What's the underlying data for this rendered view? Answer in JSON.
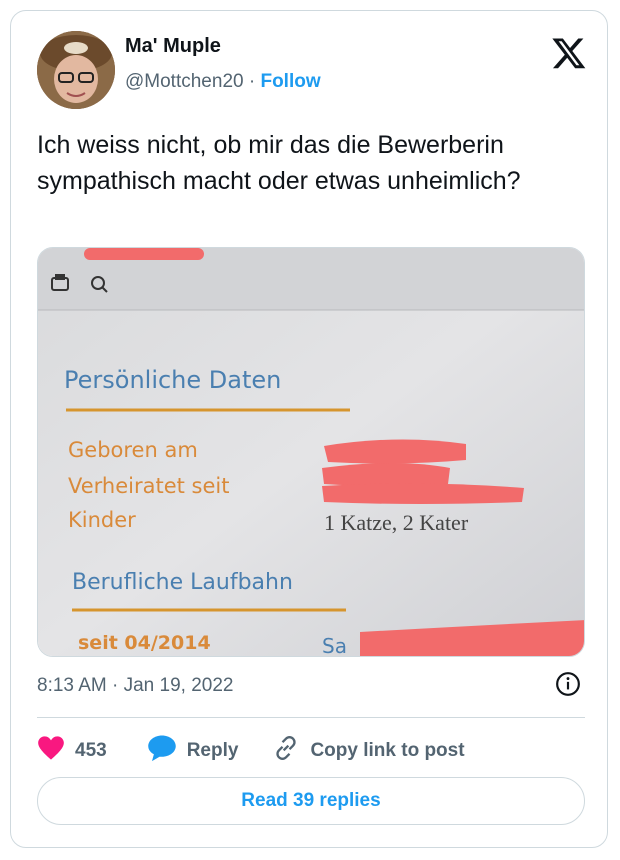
{
  "author": {
    "name": "Ma' Muple",
    "handle": "@Mottchen20",
    "separator": "·",
    "follow_label": "Follow"
  },
  "tweet": {
    "text": "Ich weiss nicht, ob mir das die Bewerberin sympathisch macht oder etwas unheimlich?"
  },
  "photo": {
    "section1": "Persönliche Daten",
    "row_geboren": "Geboren am",
    "row_verheiratet": "Verheiratet seit",
    "row_kinder": "Kinder",
    "row_kinder_value": "1 Katze, 2 Kater",
    "section2": "Berufliche Laufbahn",
    "row_seit": "seit 04/2014",
    "row_seit_value": "Sa"
  },
  "meta": {
    "timestamp": "8:13 AM · Jan 19, 2022"
  },
  "actions": {
    "like_count": "453",
    "reply_label": "Reply",
    "copy_label": "Copy link to post"
  },
  "read_replies": "Read 39 replies",
  "colors": {
    "accent": "#1d9bf0",
    "like": "#f91880",
    "photo_heading": "#4a7fb0",
    "photo_label": "#d98a3a",
    "redaction": "#f26b6b"
  },
  "icons": [
    "x-logo-icon",
    "info-icon",
    "heart-icon",
    "reply-bubble-icon",
    "link-icon",
    "print-icon",
    "zoom-icon"
  ]
}
